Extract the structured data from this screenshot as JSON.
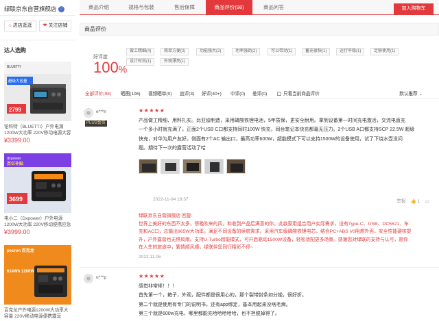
{
  "shop": {
    "name": "绿联京东自营旗舰店",
    "badge": "♡",
    "enter_btn": "进店逛逛",
    "follow_btn": "关注店铺"
  },
  "sidebar": {
    "title": "达人选购",
    "products": [
      {
        "title": "铂科特（BLUETTI）户外电源1200W大功率 220V移动电源大容量",
        "price": "¥3399.00",
        "img_price": "2799",
        "img_brand": "BLUETTI",
        "img_tag": "超级大容量"
      },
      {
        "title": "电小二（Dxpower）户外电源1200W大功率 220V移动便携应急野",
        "price": "¥3999.00",
        "img_price": "3699",
        "img_brand": "dxpower",
        "img_tag": "百亿补贴"
      },
      {
        "title": "百克龙户外电源1200W大功率大容量 220V移动电源便携露营",
        "price": "",
        "img_price": "",
        "img_brand": "pecron 百克龙",
        "img_tag": "614Wh 1200W"
      }
    ]
  },
  "tabs": [
    "商品介绍",
    "规格与包装",
    "售后保障",
    "商品评价(98)",
    "商品问答"
  ],
  "cart_btn": "加入购物车",
  "reviews_header": "商品评价",
  "rating": {
    "label": "好评度",
    "value": "100",
    "unit": "%"
  },
  "tags": [
    "做工精细(4)",
    "简单方便(2)",
    "功能强大(2)",
    "功率强劲(2)",
    "可以带动(1)",
    "蓄充很快(1)",
    "运行平稳(1)",
    "足够使用(1)",
    "设计时尚(1)",
    "外观漂亮(1)"
  ],
  "filters": [
    "全部评价(98)",
    "晒图(106)",
    "视频晒单(0)",
    "追评(3)",
    "好评(40+)",
    "中评(0)",
    "差评(0)",
    "只看当前商品评价"
  ],
  "sort": "默认推荐",
  "reviews": [
    {
      "user": "e***n",
      "badge": "PLUS会员",
      "stars": "★★★★★",
      "lines": [
        "产品做工精细、用料扎实。比亚迪制造，采用磷酸铁锂电池，5年质保，更安全耐用。拿到设备第一时间充电激活，交流电直充",
        "一个多小时就充满了。正面2个USB C口都支持同时100W 快充，同台笔记本快充都毫无压力。2个USB A口都支持SCP 22.5W 超级",
        "快充，对华为用户友好。侧面有2个AC 输出口，最高功率600W，超能模式下可以支持1500W的设备使用，试了下烧水壶没问",
        "题。期待下一次的露营活动了哈"
      ],
      "date": "2022-11-04 18:37",
      "report": "举报",
      "like": "1",
      "reply_lines": [
        "绿联京东自营旗舰店 回复:",
        "世界上美好的东西不太多，傍晚吹来的风，和收到产品后满意的你。此款家用组合用户实际需求，设有Type-C、USB、DC5521、车",
        "充和AC口，总输出965W大功率，满足不同设备的续航需求。采用汽车级磷酸铁锂电芯，结合PC+ABS V0阻燃外壳，安全性能硬核提",
        "升，户外露营也无惧风雨。支持U-Turbo超能模式，可开启驱动1500W设备，轻松适配更多场景。感谢您对绿联的支持与认可，愿你",
        "在人生的旅途中，繁情顺风顺，绿联伴您同行精彩不停~"
      ],
      "reply_date": "2022.11.06"
    },
    {
      "user": "u***p",
      "stars": "★★★★★",
      "lines": [
        "感觉非常棒！！！",
        "首先第一个，箱子，外观，配件都是很用心的，那个裂带封条如分娩，很好折。",
        "第二个就是使用有专门的说明书，还有app绑定，基本用起来没啥毛病。",
        "第三个就是600w充电，哪里都能充哈哈哈哈哈，也不担脱掉得了。"
      ]
    }
  ],
  "colors": {
    "accent": "#e4393c",
    "plus_gold": "#f5d27a"
  }
}
